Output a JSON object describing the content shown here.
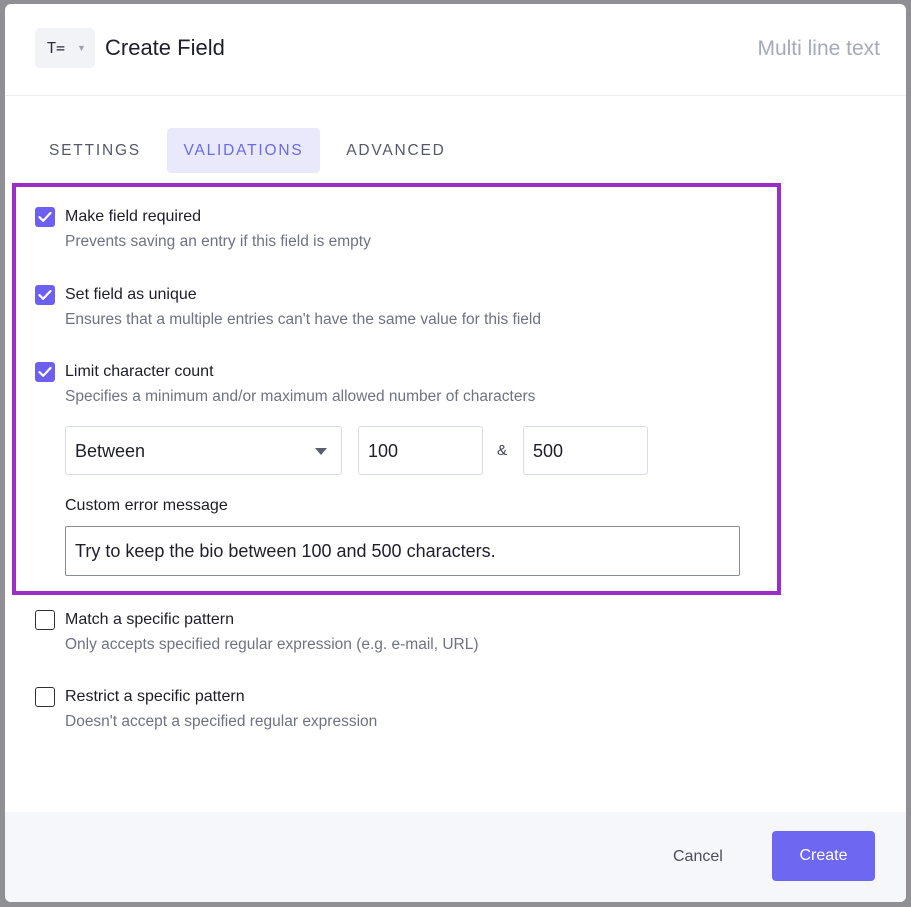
{
  "header": {
    "type_icon": "T=",
    "title": "Create Field",
    "field_type": "Multi line text"
  },
  "tabs": [
    {
      "label": "SETTINGS",
      "active": false
    },
    {
      "label": "VALIDATIONS",
      "active": true
    },
    {
      "label": "ADVANCED",
      "active": false
    }
  ],
  "validations": [
    {
      "label": "Make field required",
      "description": "Prevents saving an entry if this field is empty",
      "checked": true
    },
    {
      "label": "Set field as unique",
      "description": "Ensures that a multiple entries can't have the same value for this field",
      "checked": true
    },
    {
      "label": "Limit character count",
      "description": "Specifies a minimum and/or maximum allowed number of characters",
      "checked": true
    },
    {
      "label": "Match a specific pattern",
      "description": "Only accepts specified regular expression (e.g. e-mail, URL)",
      "checked": false
    },
    {
      "label": "Restrict a specific pattern",
      "description": "Doesn't accept a specified regular expression",
      "checked": false
    }
  ],
  "char_count": {
    "mode": "Between",
    "min": "100",
    "separator": "&",
    "max": "500"
  },
  "custom_error": {
    "label": "Custom error message",
    "value": "Try to keep the bio between 100 and 500 characters."
  },
  "footer": {
    "cancel_label": "Cancel",
    "create_label": "Create"
  },
  "colors": {
    "accent": "#6e67f2",
    "checkbox": "#6d5ff0",
    "highlight_border": "#9a2fc8",
    "active_tab_bg": "#e9e9fb"
  }
}
